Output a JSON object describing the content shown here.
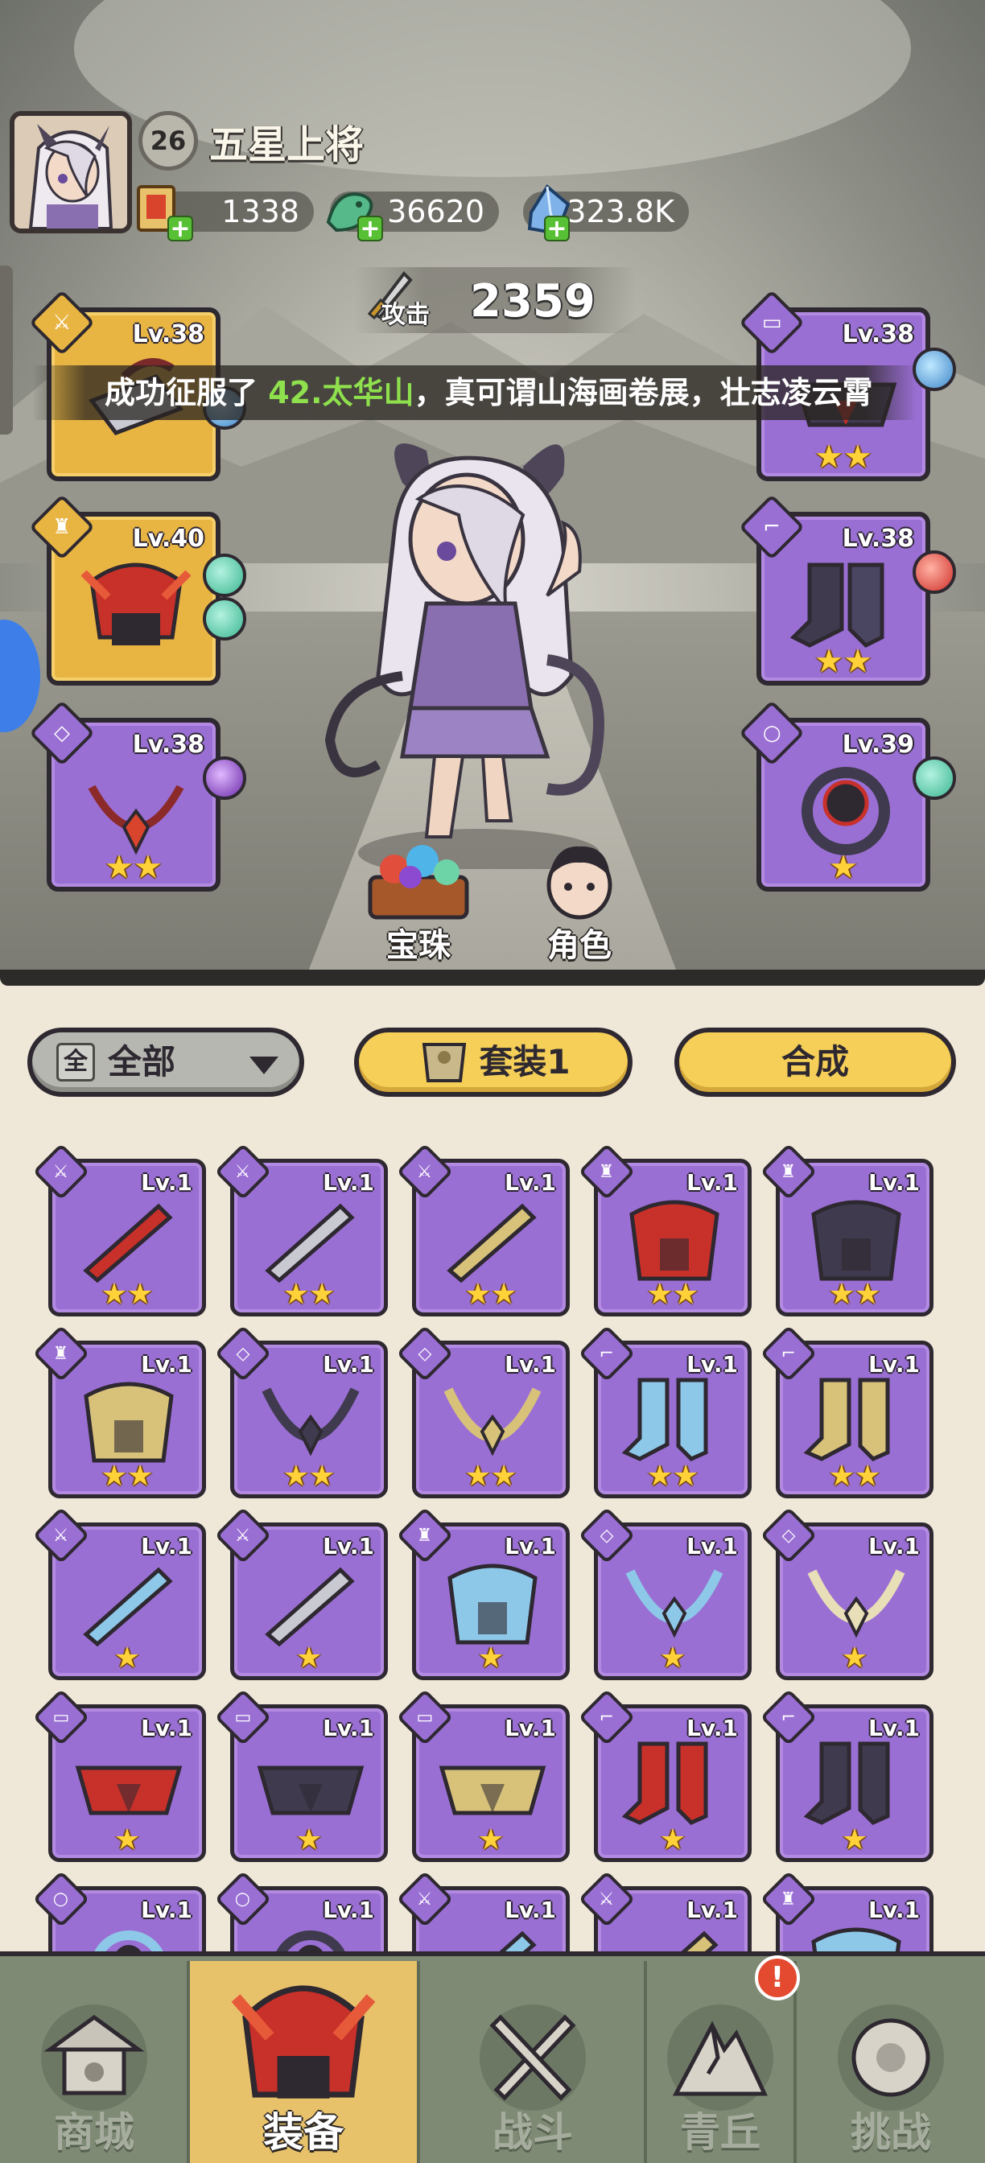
{
  "profile": {
    "level": "26",
    "rank_title": "五星上将",
    "avatar_icon": "character-portrait-icon"
  },
  "resources": [
    {
      "name": "scroll-ticket",
      "value": "1338",
      "icon": "scroll-ticket-icon"
    },
    {
      "name": "jade-dragon",
      "value": "36620",
      "icon": "jade-dragon-icon"
    },
    {
      "name": "crystal",
      "value": "323.8K",
      "icon": "blue-crystal-icon"
    }
  ],
  "attack": {
    "label": "攻击",
    "value": "2359"
  },
  "marquee": {
    "prefix": "成功征服了 ",
    "highlight": "42.太华山",
    "suffix": "，真可谓山海画卷展，壮志凌云霄"
  },
  "equipped": {
    "left": [
      {
        "level": "Lv.38",
        "rarity": "gold",
        "type_icon": "sword-icon",
        "item_icon": "hammer-weapon-icon",
        "gems": [
          "blue"
        ],
        "stars": 0
      },
      {
        "level": "Lv.40",
        "rarity": "gold",
        "type_icon": "armor-icon",
        "item_icon": "red-helmet-icon",
        "gems": [
          "teal",
          "teal"
        ],
        "stars": 0
      },
      {
        "level": "Lv.38",
        "rarity": "purple",
        "type_icon": "necklace-icon",
        "item_icon": "red-necklace-icon",
        "gems": [
          "violet"
        ],
        "stars": 2
      }
    ],
    "right": [
      {
        "level": "Lv.38",
        "rarity": "purple",
        "type_icon": "belt-icon",
        "item_icon": "dark-belt-icon",
        "gems": [
          "blue"
        ],
        "stars": 2
      },
      {
        "level": "Lv.38",
        "rarity": "purple",
        "type_icon": "boots-icon",
        "item_icon": "dark-boots-icon",
        "gems": [
          "red"
        ],
        "stars": 2
      },
      {
        "level": "Lv.39",
        "rarity": "purple",
        "type_icon": "ring-icon",
        "item_icon": "dark-ring-icon",
        "gems": [
          "teal"
        ],
        "stars": 1
      }
    ]
  },
  "center_buttons": {
    "orb": "宝珠",
    "character": "角色"
  },
  "filter": {
    "all_box": "全",
    "all_label": "全部",
    "set_label": "套装1",
    "compose_label": "合成"
  },
  "inventory": [
    {
      "level": "Lv.1",
      "type": "sword",
      "item": "red-whip",
      "stars": 2
    },
    {
      "level": "Lv.1",
      "type": "sword",
      "item": "silver-hammer",
      "stars": 2
    },
    {
      "level": "Lv.1",
      "type": "sword",
      "item": "gold-whip",
      "stars": 2
    },
    {
      "level": "Lv.1",
      "type": "armor",
      "item": "red-helmet",
      "stars": 2
    },
    {
      "level": "Lv.1",
      "type": "armor",
      "item": "dark-armor",
      "stars": 2
    },
    {
      "level": "Lv.1",
      "type": "armor",
      "item": "gold-armor",
      "stars": 2
    },
    {
      "level": "Lv.1",
      "type": "necklace",
      "item": "dark-necklace",
      "stars": 2
    },
    {
      "level": "Lv.1",
      "type": "necklace",
      "item": "gold-necklace",
      "stars": 2
    },
    {
      "level": "Lv.1",
      "type": "boots",
      "item": "ice-boots",
      "stars": 2
    },
    {
      "level": "Lv.1",
      "type": "boots",
      "item": "gold-boots",
      "stars": 2
    },
    {
      "level": "Lv.1",
      "type": "sword",
      "item": "ice-bow",
      "stars": 1
    },
    {
      "level": "Lv.1",
      "type": "sword",
      "item": "silver-hammer",
      "stars": 1
    },
    {
      "level": "Lv.1",
      "type": "armor",
      "item": "ice-armor",
      "stars": 1
    },
    {
      "level": "Lv.1",
      "type": "necklace",
      "item": "ice-necklace",
      "stars": 1
    },
    {
      "level": "Lv.1",
      "type": "necklace",
      "item": "pale-necklace",
      "stars": 1
    },
    {
      "level": "Lv.1",
      "type": "belt",
      "item": "red-belt",
      "stars": 1
    },
    {
      "level": "Lv.1",
      "type": "belt",
      "item": "dark-belt",
      "stars": 1
    },
    {
      "level": "Lv.1",
      "type": "belt",
      "item": "gold-belt",
      "stars": 1
    },
    {
      "level": "Lv.1",
      "type": "boots",
      "item": "red-boots",
      "stars": 1
    },
    {
      "level": "Lv.1",
      "type": "boots",
      "item": "dark-boots",
      "stars": 1
    },
    {
      "level": "Lv.1",
      "type": "ring",
      "item": "ice-ring",
      "stars": 0
    },
    {
      "level": "Lv.1",
      "type": "ring",
      "item": "dark-ring",
      "stars": 0
    },
    {
      "level": "Lv.1",
      "type": "sword",
      "item": "ice-sword",
      "stars": 0
    },
    {
      "level": "Lv.1",
      "type": "sword",
      "item": "gold-sword",
      "stars": 0
    },
    {
      "level": "Lv.1",
      "type": "armor",
      "item": "ice-armor-2",
      "stars": 0
    }
  ],
  "nav": [
    {
      "label": "商城",
      "icon": "shop-pavilion-icon",
      "active": false
    },
    {
      "label": "装备",
      "icon": "equipment-helmet-icon",
      "active": true
    },
    {
      "label": "战斗",
      "icon": "crossed-swords-icon",
      "active": false
    },
    {
      "label": "青丘",
      "icon": "mountain-peak-icon",
      "active": false
    },
    {
      "label": "挑战",
      "icon": "challenge-orb-icon",
      "active": false
    }
  ],
  "alert": "!",
  "colors": {
    "purple_slot": "#9a6fd4",
    "gold_slot": "#e8b543",
    "star": "#ffd23a",
    "highlight_text": "#8ee04d",
    "nav_active": "#e8c26a",
    "nav_bg": "#7e8a74"
  }
}
